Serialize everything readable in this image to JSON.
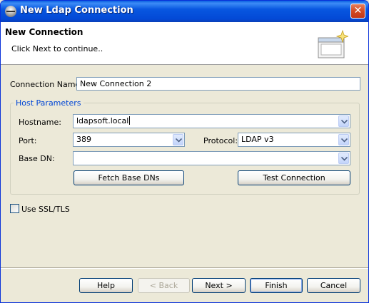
{
  "window": {
    "title": "New Ldap Connection",
    "close_symbol": "✕"
  },
  "header": {
    "title": "New Connection",
    "description": "Click Next to continue.."
  },
  "connection_name": {
    "label": "Connection Name:",
    "value": "New Connection 2"
  },
  "host_parameters": {
    "title": "Host Parameters",
    "hostname": {
      "label": "Hostname:",
      "value": "ldapsoft.local"
    },
    "port": {
      "label": "Port:",
      "value": "389"
    },
    "protocol": {
      "label": "Protocol:",
      "value": "LDAP v3"
    },
    "base_dn": {
      "label": "Base DN:",
      "value": ""
    },
    "fetch_button": "Fetch Base DNs",
    "test_button": "Test Connection"
  },
  "ssl": {
    "label": "Use SSL/TLS",
    "checked": false
  },
  "buttons": {
    "help": "Help",
    "back": "< Back",
    "next": "Next >",
    "finish": "Finish",
    "cancel": "Cancel"
  },
  "colors": {
    "title_bar": "#0a5fe0",
    "dialog_bg": "#ece9d8",
    "group_title": "#0046d5"
  }
}
